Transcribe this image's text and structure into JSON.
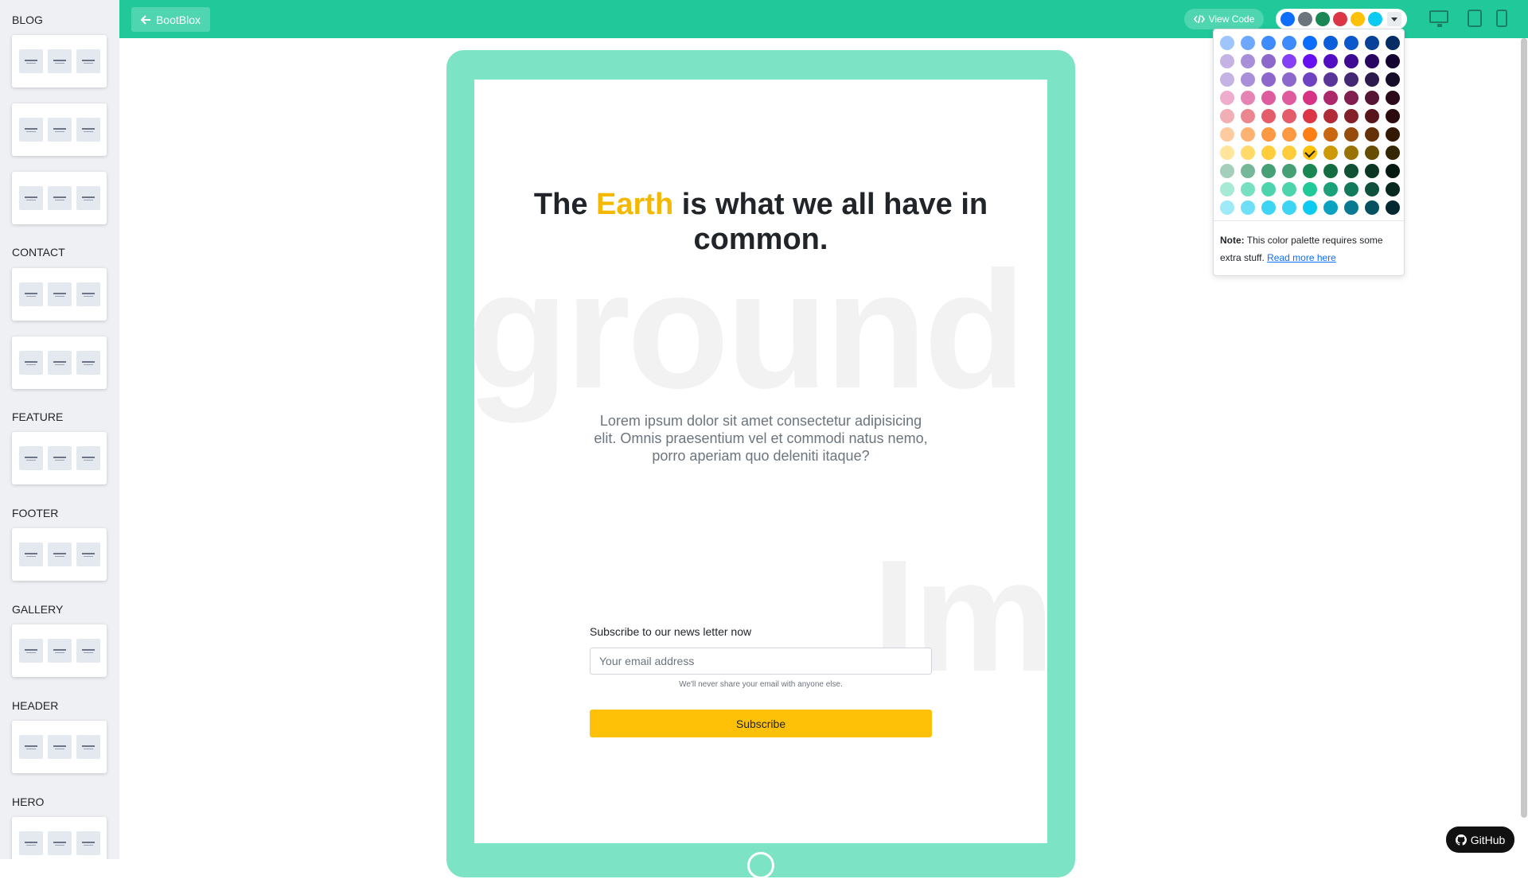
{
  "sidebar": {
    "categories": [
      "BLOG",
      "CONTACT",
      "FEATURE",
      "FOOTER",
      "GALLERY",
      "HEADER",
      "HERO"
    ]
  },
  "toolbar": {
    "back_label": "BootBlox",
    "view_code_label": "View Code",
    "theme_swatches": [
      "#0d6efd",
      "#6c757d",
      "#198754",
      "#dc3545",
      "#ffc107",
      "#0dcaf0"
    ]
  },
  "hero": {
    "title_prefix": "The ",
    "title_accent": "Earth",
    "title_suffix": " is what we all have in common.",
    "background_word_1": "ground",
    "background_word_2": "Im",
    "lead": "Lorem ipsum dolor sit amet consectetur adipisicing elit. Omnis praesentium vel et commodi natus nemo, porro aperiam quo deleniti itaque?",
    "subscribe_label": "Subscribe to our news letter now",
    "email_placeholder": "Your email address",
    "help_text": "We'll never share your email with anyone else.",
    "subscribe_button": "Subscribe"
  },
  "palette": {
    "selected": "#ffc107",
    "rows": [
      [
        "#9ec5fe",
        "#6ea8fe",
        "#3d8bfd",
        "#3d8bfd",
        "#0d6efd",
        "#0b5ed7",
        "#0a58ca",
        "#084298",
        "#052c65"
      ],
      [
        "#c5b3e6",
        "#a98eda",
        "#8c68cd",
        "#8540f5",
        "#6610f2",
        "#520dc2",
        "#3d0a91",
        "#290661",
        "#140330"
      ],
      [
        "#c5b3e6",
        "#a98eda",
        "#8c68cd",
        "#8c68cd",
        "#6f42c1",
        "#59359a",
        "#432874",
        "#2c1a4d",
        "#160d27"
      ],
      [
        "#efadce",
        "#e685b5",
        "#de5c9d",
        "#de5c9d",
        "#d63384",
        "#ab296a",
        "#801f4f",
        "#561435",
        "#2b0a1a"
      ],
      [
        "#f1aeb5",
        "#ea868f",
        "#e35d6a",
        "#e35d6a",
        "#dc3545",
        "#b02a37",
        "#842029",
        "#58151c",
        "#2c0b0e"
      ],
      [
        "#fecba1",
        "#feb272",
        "#fd9843",
        "#fd9843",
        "#fd7e14",
        "#ca6510",
        "#984c0c",
        "#653208",
        "#331904"
      ],
      [
        "#ffe69c",
        "#ffda6a",
        "#ffcd39",
        "#ffcd39",
        "#ffc107",
        "#cc9a06",
        "#997404",
        "#664d03",
        "#332701"
      ],
      [
        "#a3cfbb",
        "#75b798",
        "#479f76",
        "#479f76",
        "#198754",
        "#146c43",
        "#0f5132",
        "#0a3622",
        "#051b11"
      ],
      [
        "#a6e9d5",
        "#79dfc1",
        "#4dd4ac",
        "#4dd4ac",
        "#20c997",
        "#1aa179",
        "#13795b",
        "#0d503c",
        "#06281e"
      ],
      [
        "#9eeaf9",
        "#6edff6",
        "#3dd5f3",
        "#3dd5f3",
        "#0dcaf0",
        "#0aa2c0",
        "#087990",
        "#055160",
        "#032830"
      ]
    ],
    "note_bold": "Note:",
    "note_text": " This color palette requires some extra stuff. ",
    "note_link": "Read more here"
  },
  "devices": [
    "desktop-icon",
    "tablet-icon",
    "phone-icon"
  ],
  "github_label": "GitHub"
}
